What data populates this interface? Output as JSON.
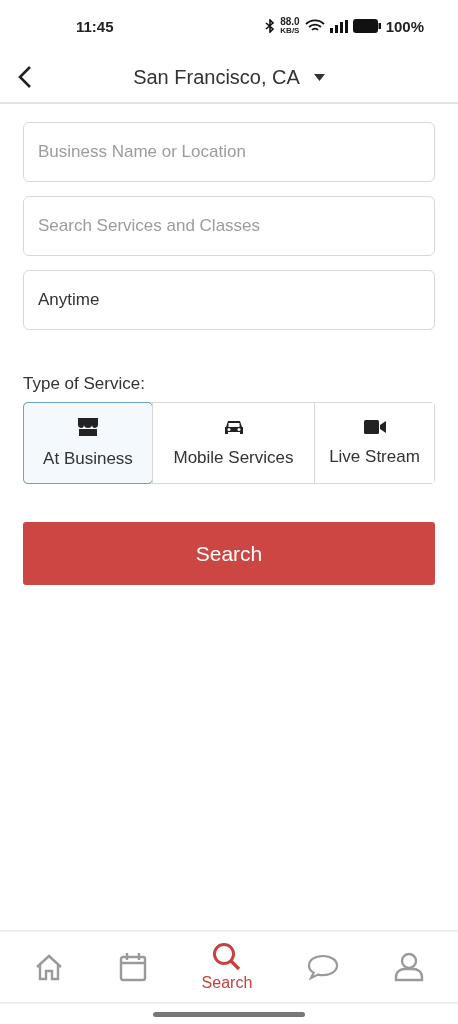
{
  "status_bar": {
    "time": "11:45",
    "speed": "88.0",
    "speed_unit": "KB/S",
    "battery": "100%"
  },
  "header": {
    "location": "San Francisco, CA"
  },
  "fields": [
    {
      "placeholder": "Business Name or Location"
    },
    {
      "placeholder": "Search Services and Classes"
    },
    {
      "value": "Anytime"
    }
  ],
  "service_type": {
    "label": "Type of Service:",
    "options": [
      {
        "kind": "store",
        "label": "At Business",
        "selected": true
      },
      {
        "kind": "car",
        "label": "Mobile Services",
        "selected": false
      },
      {
        "kind": "video",
        "label": "Live Stream",
        "selected": false
      }
    ]
  },
  "search_button": "Search",
  "nav": [
    {
      "kind": "home",
      "selected": false
    },
    {
      "kind": "calendar",
      "selected": false
    },
    {
      "kind": "search",
      "label": "Search",
      "selected": true
    },
    {
      "kind": "chat",
      "selected": false
    },
    {
      "kind": "profile",
      "selected": false
    }
  ]
}
